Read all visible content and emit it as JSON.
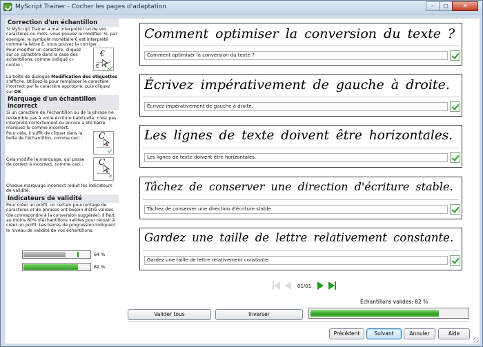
{
  "window": {
    "title": "MyScript Trainer - Cocher les pages d'adaptation",
    "min_glyph": "–",
    "max_glyph": "□",
    "close_glyph": "✕"
  },
  "help": {
    "section1": {
      "heading": "Correction d'un échantillon",
      "text1": "Si MyScript Trainer a mal interprété l'un de vos caractères ou mots, vous pouvez le modifier. Si, par exemple, le symbole monétaire € est interprété comme la lettre E, vous pouvez le corriger...",
      "text2": "Pour modifier un caractère, cliquez sur ce caractère dans la case des échantillons, comme indiqué ci-contre :",
      "thumb_top": "€",
      "thumb_bottom": "E",
      "text3_a": "La boîte de dialogue ",
      "text3_b": "Modification des étiquettes",
      "text3_c": " s'affiche. Utilisez-la pour remplacer le caractère incorrect par le caractère approprié, puis cliquez sur ",
      "text3_d": "OK",
      "text3_e": "."
    },
    "section2": {
      "heading": "Marquage d'un échantillon incorrect",
      "text1": "Si un caractère de l'échantillon ou de la phrase ne ressemble pas à votre écriture habituelle, n'est pas interprété correctement ou encore a été barré, marquez-le comme incorrect.",
      "text2": "Pour cela, il suffit de cliquer dans la boîte de l'échantillon, comme ceci :",
      "text3": "Cela modifie le marquage, qui passe de correct à incorrect, comme ceci :",
      "text4": "Chaque marquage incorrect réduit les indicateurs de validité."
    },
    "section3": {
      "heading": "Indicateurs de validité",
      "text1": "Pour créer un profil, un certain pourcentage de caractères et de phrases ont besoin d'être valides (de correspondre à la conversion suggérée). Il faut au moins 80% d'échantillons valides pour réussir à créer un profil. Les barres de progression indiquent le niveau de validité de vos échantillons.",
      "bar1_value": 64,
      "bar1_label": "64 %",
      "bar2_value": 82,
      "bar2_label": "82 %"
    }
  },
  "samples": [
    {
      "handwriting": "Comment optimiser la conversion du texte ?",
      "conversion": "Comment optimiser la conversion du texte ?",
      "valid": true
    },
    {
      "handwriting": "Écrivez impérativement de gauche à droite.",
      "conversion": "Écrivez impérativement de gauche à droite.",
      "valid": true
    },
    {
      "handwriting": "Les lignes de texte doivent être horizontales.",
      "conversion": "Les lignes de texte doivent être horizontales.",
      "valid": true
    },
    {
      "handwriting": "Tâchez de conserver une direction d'écriture stable.",
      "conversion": "Tâchez de conserver une direction d'écriture stable.",
      "valid": true
    },
    {
      "handwriting": "Gardez une taille de lettre relativement constante.",
      "conversion": "Gardez une taille de lettre relativement constante.",
      "valid": true
    }
  ],
  "pager": {
    "page": "01/01"
  },
  "validity": {
    "label": "Échantillons valides: 82 %",
    "value": 82
  },
  "buttons": {
    "validate_all": "Valider tous",
    "invert": "Inverser",
    "previous": "Précédent",
    "next": "Suivant",
    "cancel": "Annuler",
    "help": "Aide"
  },
  "colors": {
    "accent_green": "#2a9a20",
    "title_bar": "#c4d6ec"
  }
}
